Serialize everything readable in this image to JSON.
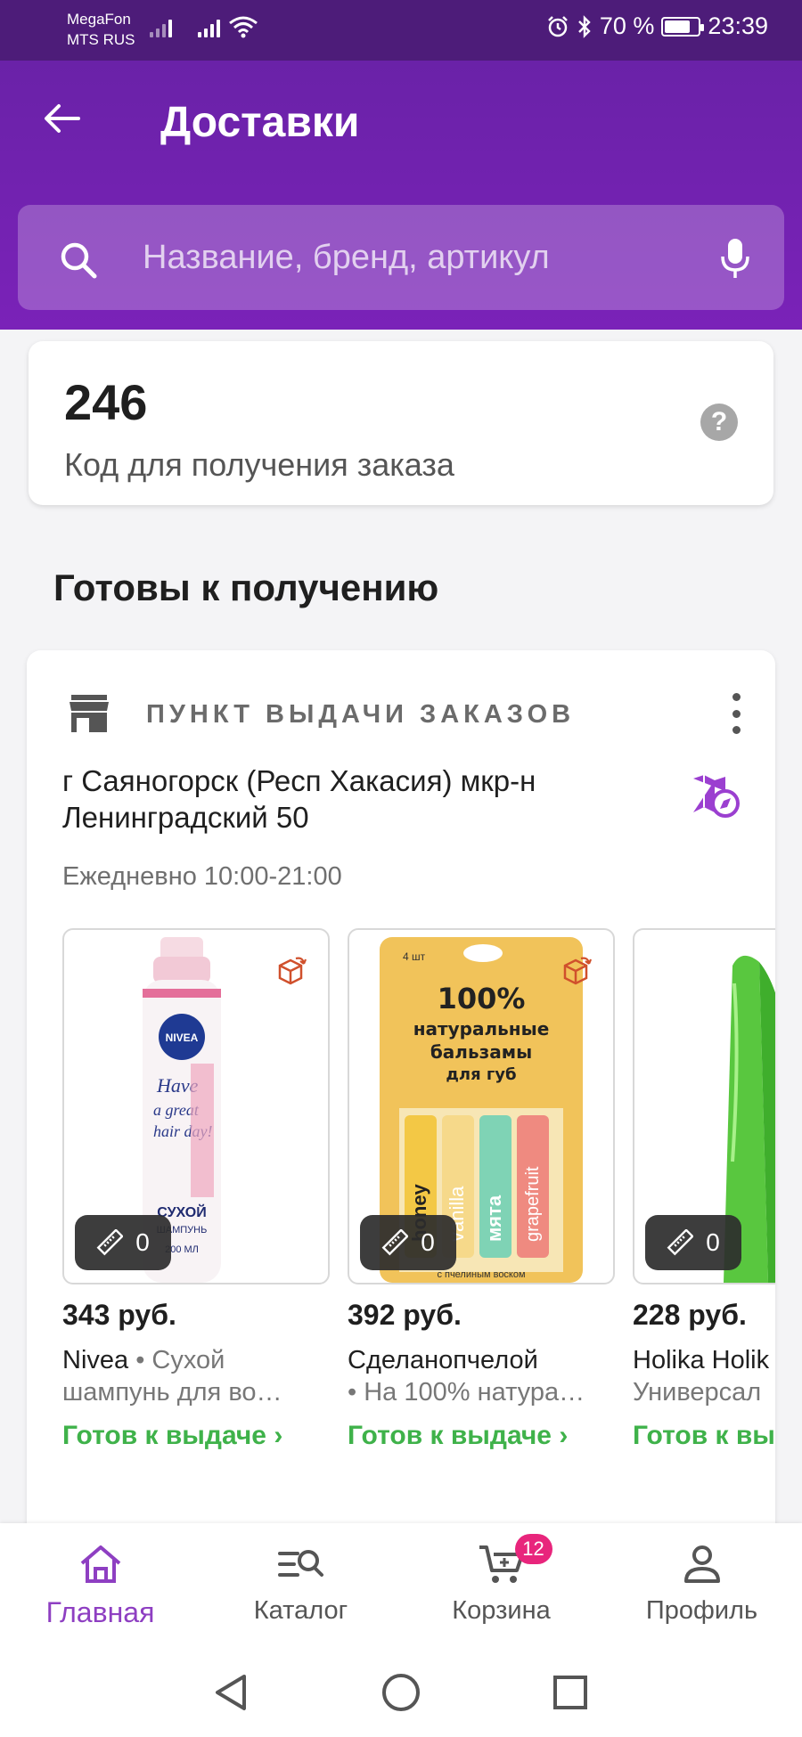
{
  "status_bar": {
    "carrier_1": "MegaFon",
    "carrier_2": "MTS RUS",
    "battery": "70 %",
    "time": "23:39"
  },
  "header": {
    "title": "Доставки",
    "search_placeholder": "Название, бренд, артикул"
  },
  "order_code": {
    "code": "246",
    "label": "Код для получения заказа"
  },
  "section_title": "Готовы к получению",
  "pickup": {
    "type_label": "ПУНКТ ВЫДАЧИ ЗАКАЗОВ",
    "address": "г Саяногорск (Респ Хакасия) мкр-н Ленинградский 50",
    "hours": "Ежедневно 10:00-21:00",
    "products": [
      {
        "price": "343 руб.",
        "brand": "Nivea",
        "desc_line1_rest": " • Сухой",
        "desc_line2": "шампунь для во…",
        "size_count": "0",
        "status": "Готов к выдаче ›",
        "image": {
          "label_top": "NIVEA",
          "line1": "Have",
          "line2": "a great",
          "line3": "hair day!",
          "name": "СУХОЙ",
          "name2": "ШАМПУНЬ",
          "volume": "200 МЛ"
        }
      },
      {
        "price": "392 руб.",
        "brand": "Сделанопчелой",
        "desc_line1_rest": "",
        "desc_line2": "• На 100% натура…",
        "size_count": "0",
        "status": "Готов к выдаче ›",
        "image": {
          "pack": "4 шт",
          "line1": "100%",
          "line2": "натуральные",
          "line3": "бальзамы",
          "line4": "для губ",
          "sticks": [
            "honey",
            "vanilla",
            "мята",
            "grapefruit"
          ],
          "bottom": "с пчелиным воском"
        }
      },
      {
        "price": "228 руб.",
        "brand": "Holika Holik",
        "desc_line1_rest": "",
        "desc_line2": "Универсал",
        "size_count": "0",
        "status": "Готов к вы"
      }
    ]
  },
  "bottom_nav": [
    {
      "label": "Главная",
      "icon": "home-icon"
    },
    {
      "label": "Каталог",
      "icon": "catalog-search-icon"
    },
    {
      "label": "Корзина",
      "icon": "cart-icon",
      "badge": "12"
    },
    {
      "label": "Профиль",
      "icon": "profile-icon"
    }
  ],
  "colors": {
    "status_bar": "#4d1c79",
    "header": "#7a22b8",
    "accent": "#8e3fc2",
    "ready_green": "#3fb24a",
    "badge_pink": "#e8257c"
  }
}
